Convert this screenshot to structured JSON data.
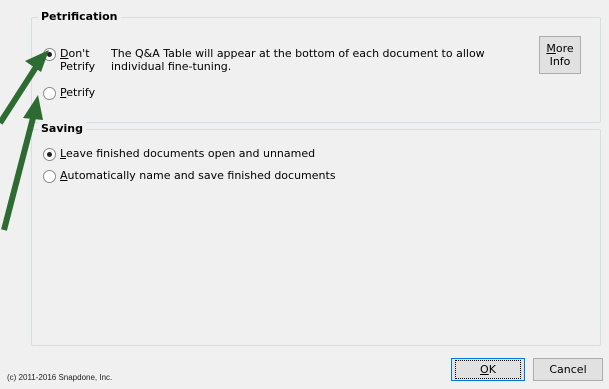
{
  "petrification": {
    "title": "Petrification",
    "options": [
      {
        "label": "Don't\nPetrify",
        "checked": true
      },
      {
        "label": "Petrify",
        "checked": false
      }
    ],
    "description": "The Q&A Table will appear at the bottom of each document to allow individual fine-tuning.",
    "more_info_label": "More\nInfo"
  },
  "saving": {
    "title": "Saving",
    "options": [
      {
        "label": "Leave finished documents open and unnamed",
        "checked": true
      },
      {
        "label": "Automatically name and save finished documents",
        "checked": false
      }
    ]
  },
  "footer": {
    "copyright": "(c) 2011-2016 Snapdone, Inc."
  },
  "buttons": {
    "ok": "OK",
    "cancel": "Cancel"
  },
  "colors": {
    "arrow": "#2e6b33",
    "dialog_bg": "#f0f0f0",
    "group_border": "#d5dfe5",
    "default_button_border": "#0078d7"
  }
}
